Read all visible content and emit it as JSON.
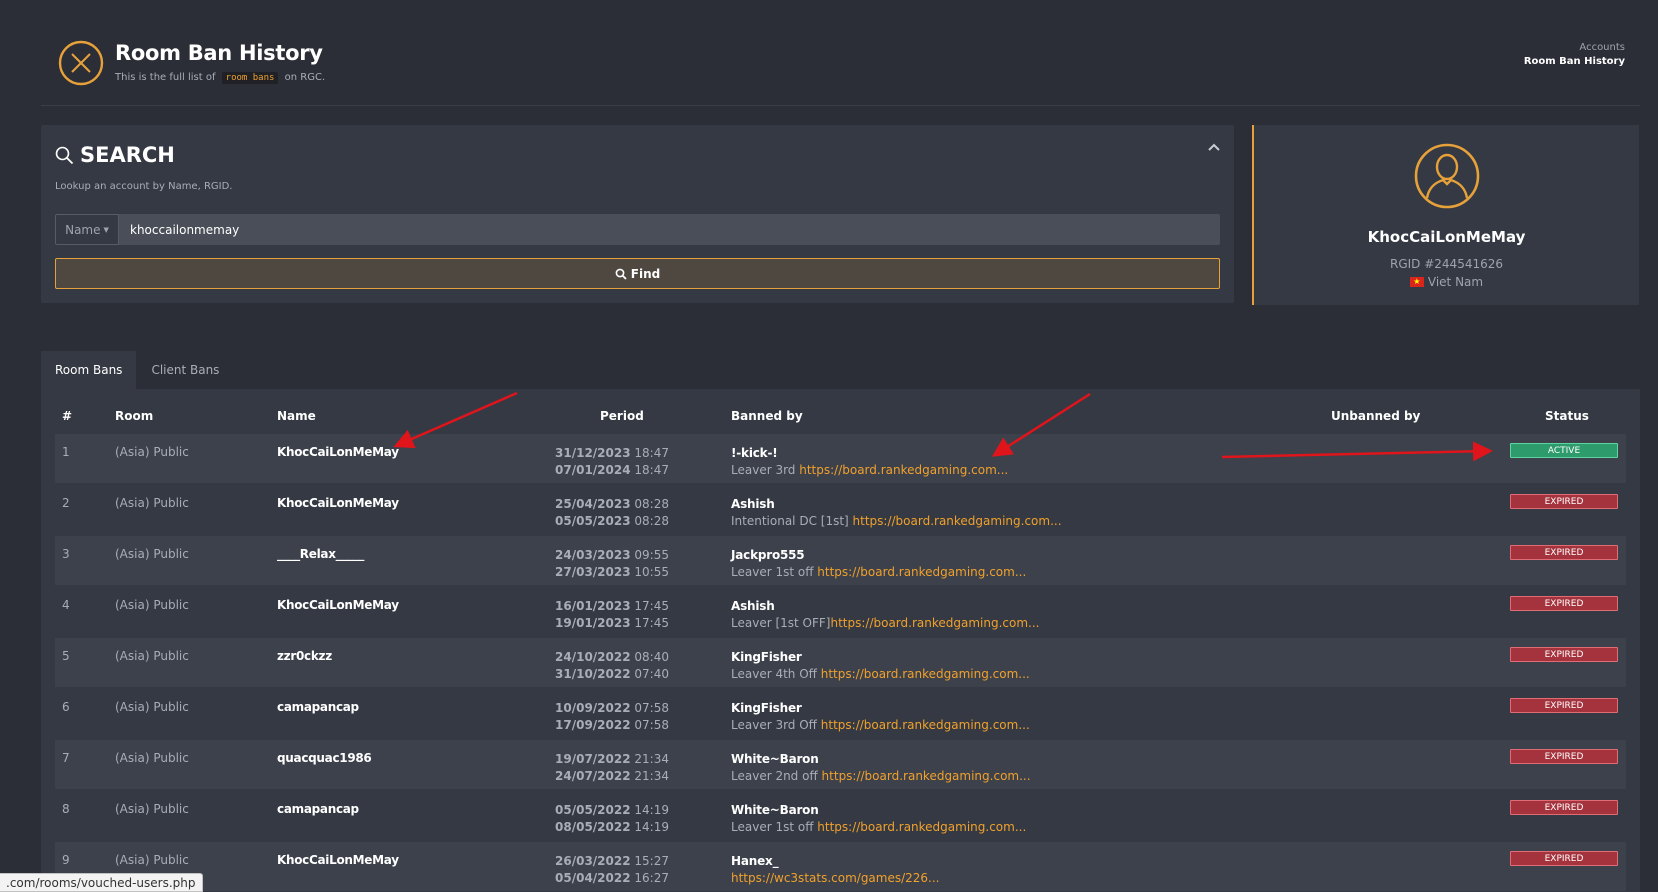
{
  "header": {
    "title": "Room Ban History",
    "subtitle_before": "This is the full list of",
    "subtitle_code": "room bans",
    "subtitle_after": "on RGC.",
    "breadcrumb_parent": "Accounts",
    "breadcrumb_current": "Room Ban History"
  },
  "search": {
    "title": "SEARCH",
    "description": "Lookup an account by Name, RGID.",
    "select_label": "Name",
    "input_value": "khoccailonmemay",
    "find_label": "Find"
  },
  "profile": {
    "name": "KhocCaiLonMeMay",
    "rgid": "RGID #244541626",
    "country": "Viet Nam"
  },
  "tabs": [
    {
      "label": "Room Bans",
      "active": true
    },
    {
      "label": "Client Bans",
      "active": false
    }
  ],
  "table": {
    "columns": {
      "num": "#",
      "room": "Room",
      "name": "Name",
      "period": "Period",
      "banned_by": "Banned by",
      "unbanned_by": "Unbanned by",
      "status": "Status"
    },
    "rows": [
      {
        "num": "1",
        "room": "(Asia) Public",
        "name": "KhocCaiLonMeMay",
        "start_date": "31/12/2023",
        "start_time": "18:47",
        "end_date": "07/01/2024",
        "end_time": "18:47",
        "banned_by": "!-kick-!",
        "reason": "Leaver 3rd ",
        "link": "https://board.rankedgaming.com...",
        "unbanned_by": "",
        "status": "ACTIVE"
      },
      {
        "num": "2",
        "room": "(Asia) Public",
        "name": "KhocCaiLonMeMay",
        "start_date": "25/04/2023",
        "start_time": "08:28",
        "end_date": "05/05/2023",
        "end_time": "08:28",
        "banned_by": "Ashish",
        "reason": "Intentional DC [1st] ",
        "link": "https://board.rankedgaming.com...",
        "unbanned_by": "",
        "status": "EXPIRED"
      },
      {
        "num": "3",
        "room": "(Asia) Public",
        "name": "____Relax_____",
        "start_date": "24/03/2023",
        "start_time": "09:55",
        "end_date": "27/03/2023",
        "end_time": "10:55",
        "banned_by": "Jackpro555",
        "reason": "Leaver 1st off ",
        "link": "https://board.rankedgaming.com...",
        "unbanned_by": "",
        "status": "EXPIRED"
      },
      {
        "num": "4",
        "room": "(Asia) Public",
        "name": "KhocCaiLonMeMay",
        "start_date": "16/01/2023",
        "start_time": "17:45",
        "end_date": "19/01/2023",
        "end_time": "17:45",
        "banned_by": "Ashish",
        "reason": "Leaver [1st OFF]",
        "link": "https://board.rankedgaming.com...",
        "unbanned_by": "",
        "status": "EXPIRED"
      },
      {
        "num": "5",
        "room": "(Asia) Public",
        "name": "zzr0ckzz",
        "start_date": "24/10/2022",
        "start_time": "08:40",
        "end_date": "31/10/2022",
        "end_time": "07:40",
        "banned_by": "KingFisher",
        "reason": "Leaver 4th Off ",
        "link": "https://board.rankedgaming.com...",
        "unbanned_by": "",
        "status": "EXPIRED"
      },
      {
        "num": "6",
        "room": "(Asia) Public",
        "name": "camapancap",
        "start_date": "10/09/2022",
        "start_time": "07:58",
        "end_date": "17/09/2022",
        "end_time": "07:58",
        "banned_by": "KingFisher",
        "reason": "Leaver 3rd Off ",
        "link": "https://board.rankedgaming.com...",
        "unbanned_by": "",
        "status": "EXPIRED"
      },
      {
        "num": "7",
        "room": "(Asia) Public",
        "name": "quacquac1986",
        "start_date": "19/07/2022",
        "start_time": "21:34",
        "end_date": "24/07/2022",
        "end_time": "21:34",
        "banned_by": "White~Baron",
        "reason": "Leaver 2nd off ",
        "link": "https://board.rankedgaming.com...",
        "unbanned_by": "",
        "status": "EXPIRED"
      },
      {
        "num": "8",
        "room": "(Asia) Public",
        "name": "camapancap",
        "start_date": "05/05/2022",
        "start_time": "14:19",
        "end_date": "08/05/2022",
        "end_time": "14:19",
        "banned_by": "White~Baron",
        "reason": "Leaver 1st off ",
        "link": "https://board.rankedgaming.com...",
        "unbanned_by": "",
        "status": "EXPIRED"
      },
      {
        "num": "9",
        "room": "(Asia) Public",
        "name": "KhocCaiLonMeMay",
        "start_date": "26/03/2022",
        "start_time": "15:27",
        "end_date": "05/04/2022",
        "end_time": "16:27",
        "banned_by": "Hanex_",
        "reason": "",
        "link": "https://wc3stats.com/games/226...",
        "unbanned_by": "",
        "status": "EXPIRED"
      }
    ]
  },
  "browser_status_url": ".com/rooms/vouched-users.php",
  "colors": {
    "accent": "#e6a13a",
    "link": "#f0a12c",
    "active": "#2e9b6c",
    "expired": "#a5333d",
    "annotation_arrow": "#e0141b"
  }
}
